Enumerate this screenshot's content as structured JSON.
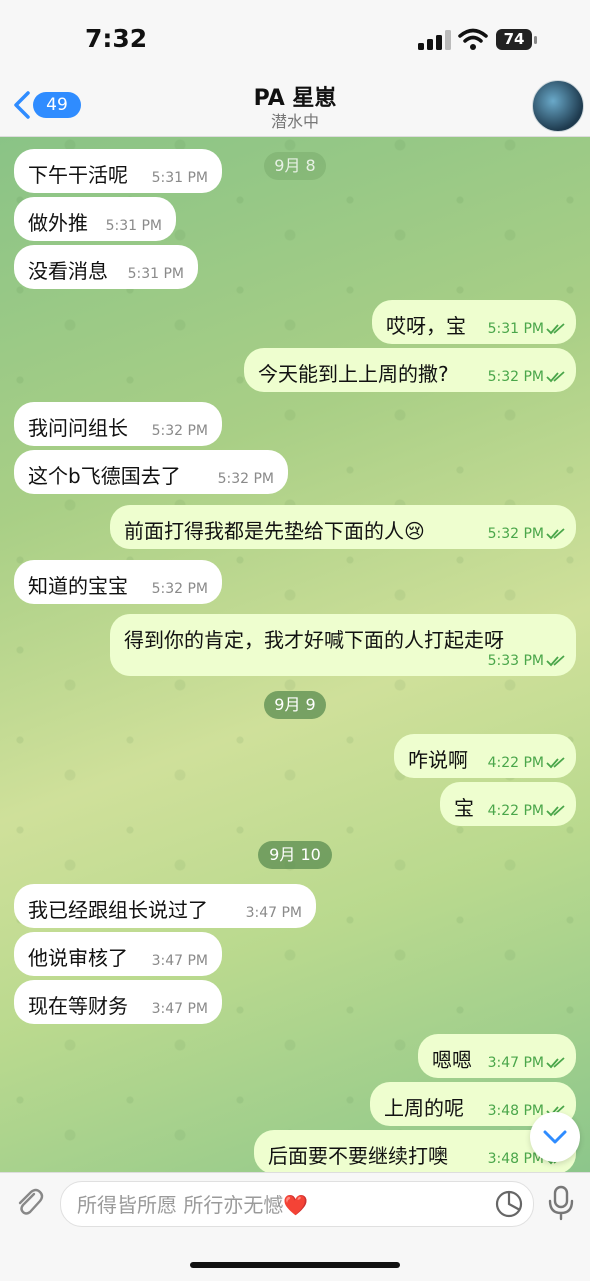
{
  "status": {
    "time": "7:32",
    "battery": "74"
  },
  "header": {
    "back_count": "49",
    "title": "PA 星崽",
    "subtitle": "潜水中"
  },
  "dates": [
    "9月 8",
    "9月 9",
    "9月 10"
  ],
  "messages": [
    {
      "text": "下午干活呢",
      "time": "5:31 PM",
      "side": "in"
    },
    {
      "text": "做外推",
      "time": "5:31 PM",
      "side": "in"
    },
    {
      "text": "没看消息",
      "time": "5:31 PM",
      "side": "in"
    },
    {
      "text": "哎呀，宝",
      "time": "5:31 PM",
      "side": "out"
    },
    {
      "text": "今天能到上上周的撒?",
      "time": "5:32 PM",
      "side": "out"
    },
    {
      "text": "我问问组长",
      "time": "5:32 PM",
      "side": "in"
    },
    {
      "text": "这个b飞德国去了",
      "time": "5:32 PM",
      "side": "in"
    },
    {
      "text": "前面打得我都是先垫给下面的人😢",
      "time": "5:32 PM",
      "side": "out"
    },
    {
      "text": "知道的宝宝",
      "time": "5:32 PM",
      "side": "in"
    },
    {
      "text": "得到你的肯定，我才好喊下面的人打起走呀",
      "time": "5:33 PM",
      "side": "out"
    },
    {
      "text": "咋说啊",
      "time": "4:22 PM",
      "side": "out"
    },
    {
      "text": "宝",
      "time": "4:22 PM",
      "side": "out"
    },
    {
      "text": "我已经跟组长说过了",
      "time": "3:47 PM",
      "side": "in"
    },
    {
      "text": "他说审核了",
      "time": "3:47 PM",
      "side": "in"
    },
    {
      "text": "现在等财务",
      "time": "3:47 PM",
      "side": "in"
    },
    {
      "text": "嗯嗯",
      "time": "3:47 PM",
      "side": "out"
    },
    {
      "text": "上周的呢",
      "time": "3:48 PM",
      "side": "out"
    },
    {
      "text": "后面要不要继续打噢",
      "time": "3:48 PM",
      "side": "out"
    }
  ],
  "input": {
    "placeholder": "所得皆所愿 所行亦无憾❤️"
  },
  "icons": {
    "attach": "paperclip-icon",
    "sticker": "sticker-icon",
    "mic": "microphone-icon",
    "scroll": "chevron-down-icon"
  }
}
